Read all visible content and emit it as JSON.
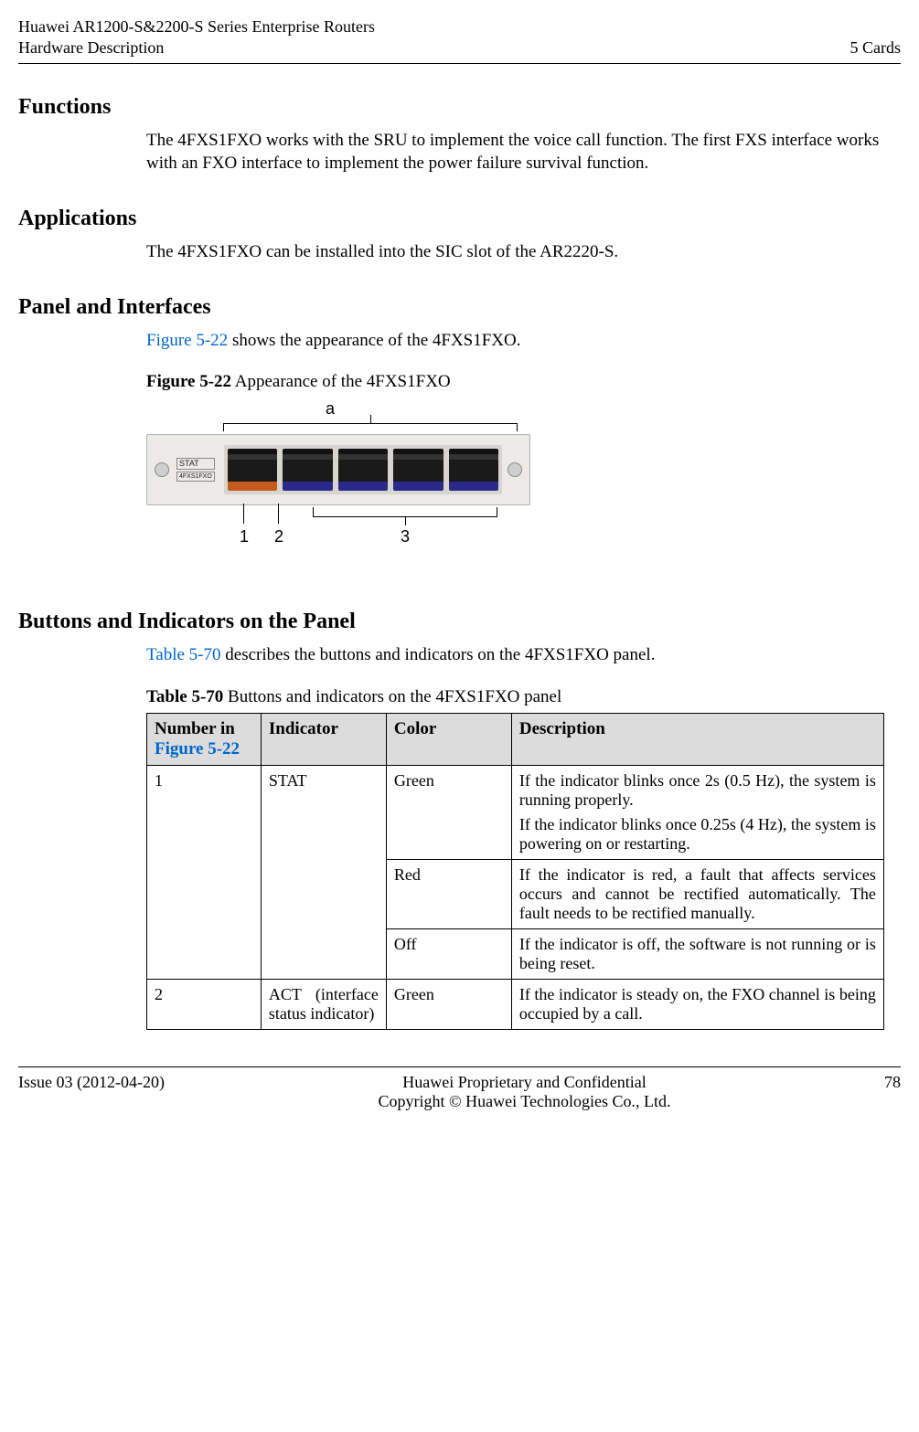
{
  "header": {
    "left_line1": "Huawei AR1200-S&2200-S Series Enterprise Routers",
    "left_line2": "Hardware Description",
    "right": "5 Cards"
  },
  "sections": {
    "functions": {
      "heading": "Functions",
      "paragraph": "The 4FXS1FXO works with the SRU to implement the voice call function. The first FXS interface works with an FXO interface to implement the power failure survival function."
    },
    "applications": {
      "heading": "Applications",
      "paragraph": "The 4FXS1FXO can be installed into the SIC slot of the AR2220-S."
    },
    "panel": {
      "heading": "Panel and Interfaces",
      "intro_part1": "Figure 5-22",
      "intro_part2": " shows the appearance of the 4FXS1FXO.",
      "figure_ref": "Figure 5-22",
      "figure_caption_rest": " Appearance of the 4FXS1FXO"
    },
    "buttons": {
      "heading": "Buttons and Indicators on the Panel",
      "intro_part1": "Table 5-70",
      "intro_part2": " describes the buttons and indicators on the 4FXS1FXO panel.",
      "table_ref": "Table 5-70",
      "table_caption_rest": " Buttons and indicators on the 4FXS1FXO panel"
    }
  },
  "figure_labels": {
    "a": "a",
    "l1": "1",
    "l2": "2",
    "l3": "3",
    "stat": "STAT",
    "model": "4FXS1FXO"
  },
  "table": {
    "headers": {
      "c1a": "Number in",
      "c1b": " Figure 5-22",
      "c2": "Indicator",
      "c3": "Color",
      "c4": "Description"
    },
    "rows": [
      {
        "num": "1",
        "indicator": "STAT",
        "subrows": [
          {
            "color": "Green",
            "desc_p1": "If the indicator blinks once 2s (0.5 Hz), the system is running properly.",
            "desc_p2": "If the indicator blinks once 0.25s (4 Hz), the system is powering on or restarting."
          },
          {
            "color": "Red",
            "desc_p1": "If the indicator is red, a fault that affects services occurs and cannot be rectified automatically. The fault needs to be rectified manually."
          },
          {
            "color": "Off",
            "desc_p1": "If the indicator is off, the software is not running or is being reset."
          }
        ]
      },
      {
        "num": "2",
        "indicator": "ACT (interface status indicator)",
        "subrows": [
          {
            "color": "Green",
            "desc_p1": "If the indicator is steady on, the FXO channel is being occupied by a call."
          }
        ]
      }
    ]
  },
  "footer": {
    "left": "Issue 03 (2012-04-20)",
    "center_line1": "Huawei Proprietary and Confidential",
    "center_line2": "Copyright © Huawei Technologies Co., Ltd.",
    "right": "78"
  }
}
